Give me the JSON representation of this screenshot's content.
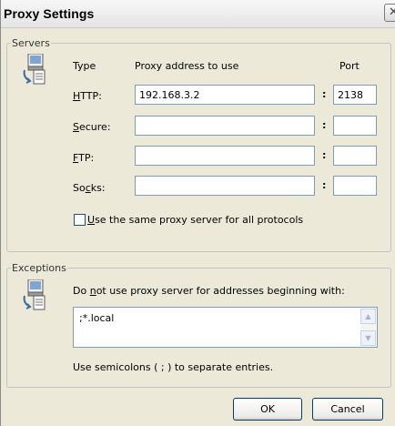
{
  "window": {
    "title": "Proxy Settings",
    "close_glyph": "✕"
  },
  "servers": {
    "legend": "Servers",
    "icon": "network-computer-icon",
    "col_type": "Type",
    "col_address": "Proxy address to use",
    "col_port": "Port",
    "rows": [
      {
        "label_pre": "",
        "label_key": "H",
        "label_post": "TTP:",
        "address": "192.168.3.2",
        "port": "2138"
      },
      {
        "label_pre": "",
        "label_key": "S",
        "label_post": "ecure:",
        "address": "",
        "port": ""
      },
      {
        "label_pre": "",
        "label_key": "F",
        "label_post": "TP:",
        "address": "",
        "port": ""
      },
      {
        "label_pre": "So",
        "label_key": "c",
        "label_post": "ks:",
        "address": "",
        "port": ""
      }
    ],
    "colon": ":",
    "same_proxy_key": "U",
    "same_proxy_rest": "se the same proxy server for all protocols",
    "same_proxy_checked": false
  },
  "exceptions": {
    "legend": "Exceptions",
    "icon": "network-computer-icon",
    "desc_pre": "Do ",
    "desc_key": "n",
    "desc_post": "ot use proxy server for addresses beginning with:",
    "value": ";*.local",
    "hint": "Use semicolons ( ; ) to separate entries."
  },
  "buttons": {
    "ok": "OK",
    "cancel": "Cancel"
  }
}
